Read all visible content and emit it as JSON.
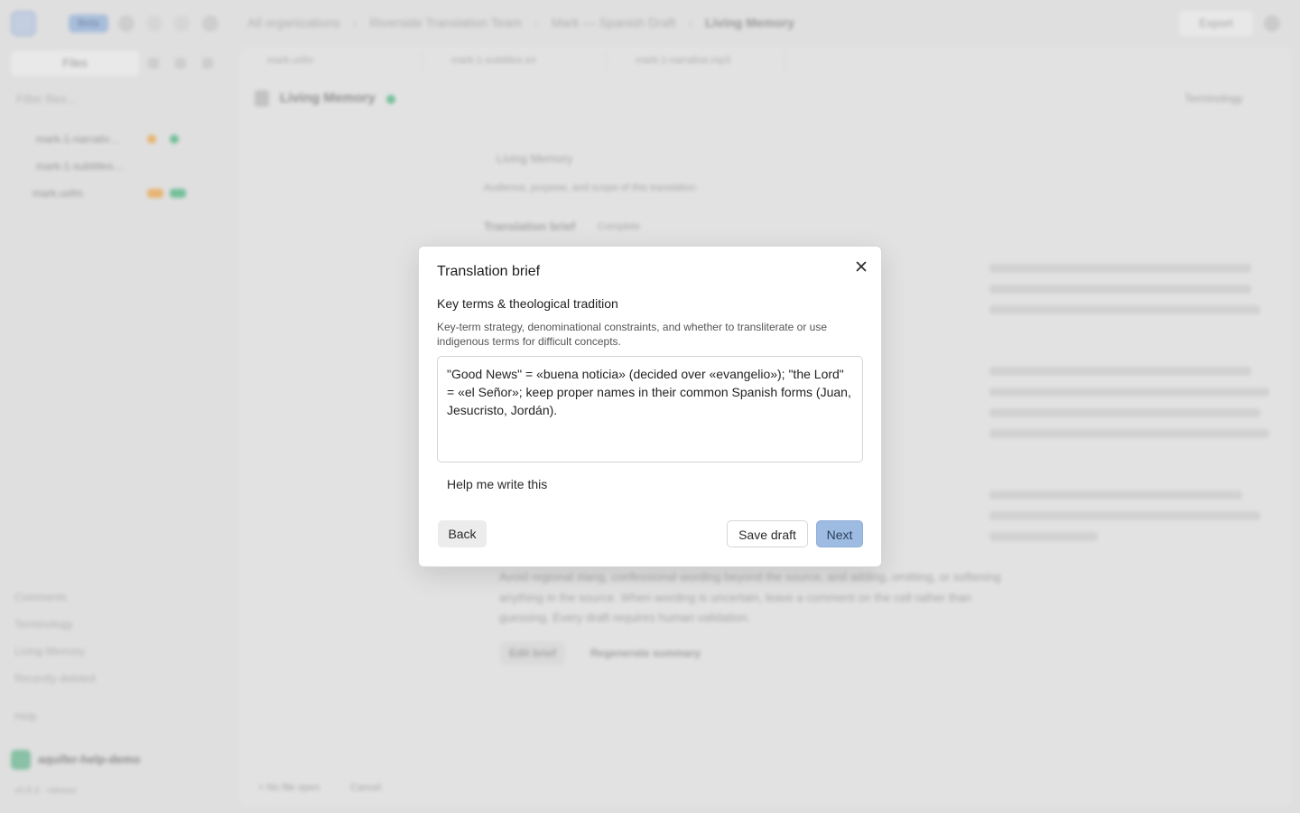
{
  "topbar": {
    "brand_label": "Beta",
    "breadcrumbs": [
      "All organizations",
      "Riverside Translation Team",
      "Mark — Spanish Draft",
      "Living Memory"
    ],
    "export_label": "Export"
  },
  "sidebar": {
    "files_tab": "Files",
    "filter_placeholder": "Filter files…",
    "files": [
      {
        "label": "mark-1-narrativ…"
      },
      {
        "label": "mark-1-subtitles…"
      },
      {
        "label": "mark.usfm"
      }
    ],
    "nav": [
      "Comments",
      "Terminology",
      "Living Memory",
      "Recently deleted"
    ],
    "help": "Help",
    "workspace_name": "aquifer-help-demo",
    "footer_text": "v0.8.3 · release"
  },
  "tabs": [
    "mark.usfm",
    "mark-1-subtitles.srt",
    "mark-1-narrative.mp3"
  ],
  "doc": {
    "title": "Living Memory",
    "terminology_label": "Terminology",
    "back_link": "Living Memory",
    "subtitle": "Audience, purpose, and scope of this translation",
    "tab_brief": "Translation brief",
    "tab_complete": "Complete",
    "paragraph_bottom": "Avoid regional slang, confessional wording beyond the source, and adding, omitting, or softening anything in the source. When wording is uncertain, leave a comment on the cell rather than guessing. Every draft requires human validation.",
    "edit_brief": "Edit brief",
    "regenerate": "Regenerate summary",
    "footer_left": "+ No file open",
    "footer_right": "Cancel"
  },
  "dialog": {
    "title": "Translation brief",
    "section_title": "Key terms & theological tradition",
    "section_description": "Key-term strategy, denominational constraints, and whether to transliterate or use indigenous terms for difficult concepts.",
    "answer_value": "\"Good News\" = «buena noticia» (decided over «evangelio»); \"the Lord\" = «el Señor»; keep proper names in their common Spanish forms (Juan, Jesucristo, Jordán).",
    "help_link": "Help me write this",
    "back_label": "Back",
    "save_draft_label": "Save draft",
    "next_label": "Next"
  },
  "colors": {
    "primary_button": "#9ebce2",
    "status_green": "#3fb27a",
    "status_orange": "#f0a23c"
  }
}
